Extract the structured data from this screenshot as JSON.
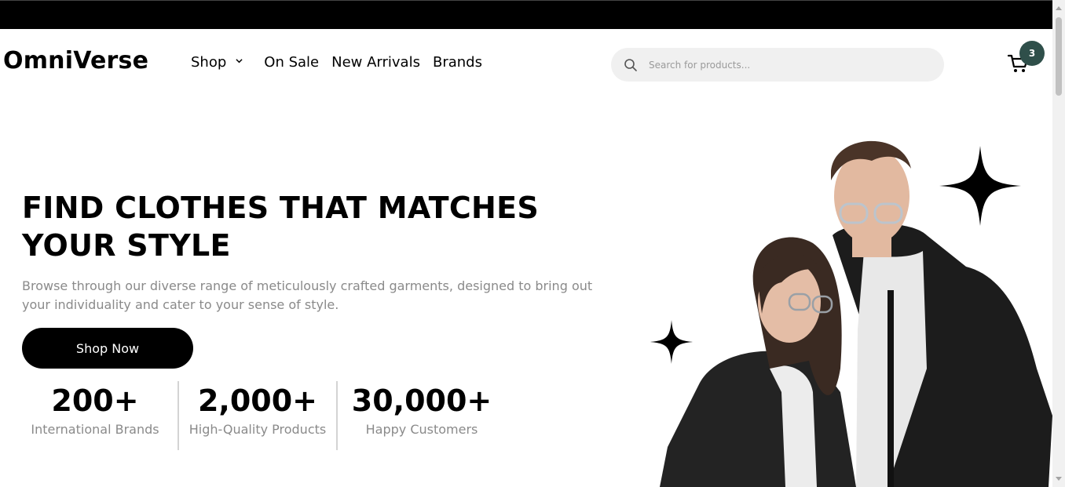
{
  "brand": {
    "name": "OmniVerse"
  },
  "nav": {
    "items": [
      {
        "label": "Shop",
        "has_dropdown": true
      },
      {
        "label": "On Sale"
      },
      {
        "label": "New Arrivals"
      },
      {
        "label": "Brands"
      }
    ]
  },
  "search": {
    "placeholder": "Search for products...",
    "value": "",
    "icon": "search-icon"
  },
  "cart": {
    "icon": "cart-icon",
    "count": "3",
    "badge_color": "#2f4f4a"
  },
  "hero": {
    "title": "FIND CLOTHES THAT MATCHES YOUR STYLE",
    "description": "Browse through our diverse range of meticulously crafted garments, designed to bring out your individuality and cater to your sense of style.",
    "cta_label": "Shop Now"
  },
  "stats": [
    {
      "value": "200+",
      "label": "International Brands"
    },
    {
      "value": "2,000+",
      "label": "High-Quality Products"
    },
    {
      "value": "30,000+",
      "label": "Happy Customers"
    }
  ],
  "colors": {
    "primary": "#000000",
    "muted_text": "#8a8a8a",
    "search_bg": "#f0f0f0"
  }
}
